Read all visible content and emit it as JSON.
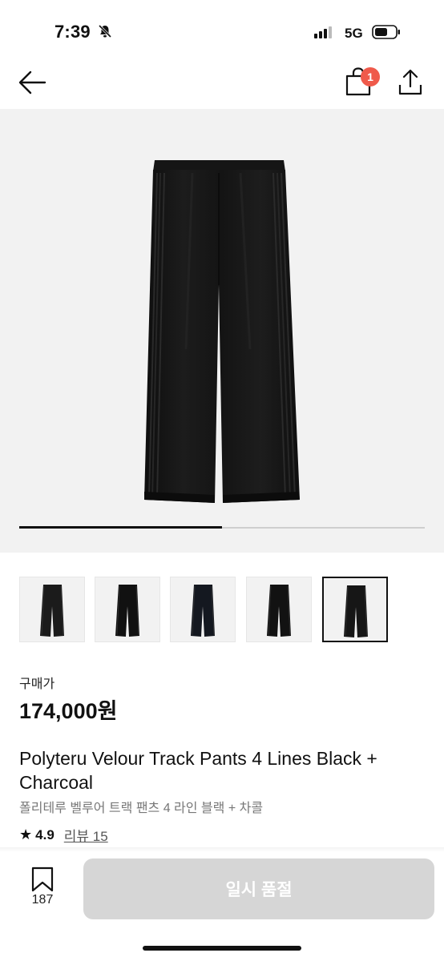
{
  "status_bar": {
    "time": "7:39",
    "network": "5G"
  },
  "nav": {
    "cart_count": "1"
  },
  "gallery": {
    "image_count": 5,
    "selected_index": 4,
    "progress": 0.5
  },
  "product": {
    "price_label": "구매가",
    "price": "174,000원",
    "title": "Polyteru Velour Track Pants 4 Lines Black + Charcoal",
    "subtitle": "폴리테루 벨루어 트랙 팬츠 4 라인 블랙 + 차콜",
    "rating": "4.9",
    "reviews": "리뷰 15"
  },
  "bottom_bar": {
    "bookmark_count": "187",
    "action_label": "일시 품절"
  },
  "colors": {
    "badge": "#ef5a4b",
    "disabled_button": "#d6d6d6",
    "image_bg": "#f2f2f2"
  },
  "icons": [
    "bell-slash-icon",
    "signal-icon",
    "battery-icon",
    "back-arrow-icon",
    "shopping-bag-icon",
    "share-icon",
    "bookmark-icon",
    "star-icon"
  ]
}
